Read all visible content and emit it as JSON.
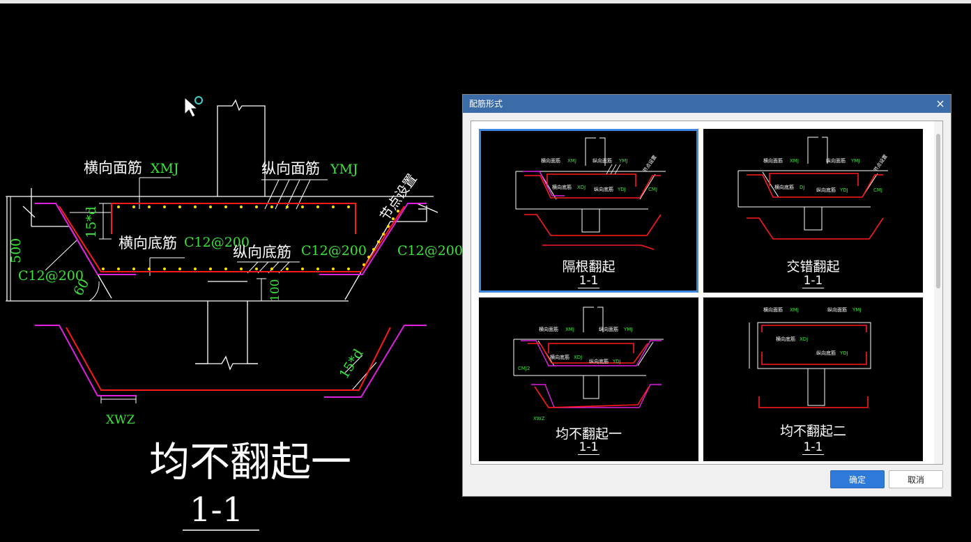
{
  "drawing": {
    "labels": {
      "transverse_top": "横向面筋",
      "transverse_top_code": "XMJ",
      "longitudinal_top": "纵向面筋",
      "longitudinal_top_code": "YMJ",
      "node_setting": "节点设置",
      "anchor": "15*d",
      "transverse_bottom": "横向底筋",
      "transverse_bottom_code": "C12@200",
      "longitudinal_bottom": "纵向底筋",
      "longitudinal_bottom_code": "C12@200",
      "side_right_code": "C12@200",
      "side_left_code": "C12@200",
      "height": "500",
      "angle": "60",
      "bottom_height": "100",
      "anchor_lower": "15*d",
      "xwz": "XWZ",
      "big_title": "均不翻起一",
      "section": "1-1"
    }
  },
  "dialog": {
    "title": "配筋形式",
    "close": "×",
    "tiles": [
      {
        "title": "隔根翻起",
        "section": "1-1",
        "selected": true
      },
      {
        "title": "交错翻起",
        "section": "1-1",
        "selected": false
      },
      {
        "title": "均不翻起一",
        "section": "1-1",
        "selected": false
      },
      {
        "title": "均不翻起二",
        "section": "1-1",
        "selected": false
      }
    ],
    "ok_label": "确定",
    "cancel_label": "取消"
  },
  "colors": {
    "line": "#ffffff",
    "rebar": "#ff1a1a",
    "magenta": "#e020e0",
    "label_green": "#39e639",
    "dot": "#ffdd00"
  }
}
